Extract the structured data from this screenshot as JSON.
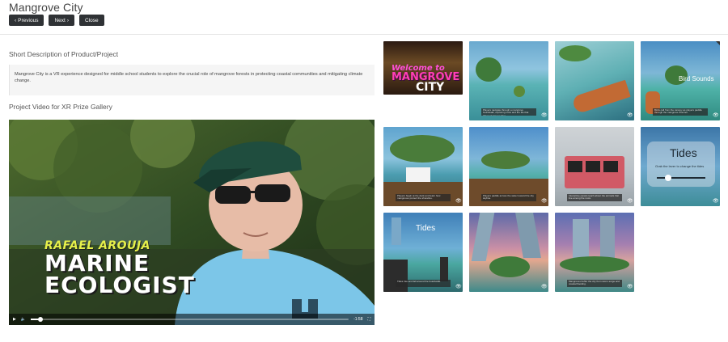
{
  "page": {
    "title": "Mangrove City"
  },
  "nav": {
    "previous": "Previous",
    "next": "Next",
    "close": "Close"
  },
  "description": {
    "heading": "Short Description of Product/Project",
    "text": "Mangrove City is a VR experience designed for middle school students to explore the crucial role of mangrove forests in protecting coastal communities and mitigating climate change."
  },
  "video": {
    "heading": "Project Video for XR Prize Gallery",
    "lower_third_name": "RAFAEL AROUJA",
    "lower_third_title_1": "MARINE",
    "lower_third_title_2": "ECOLOGIST",
    "time_remaining": "-1:58",
    "progress_fraction": 0.03
  },
  "gallery": {
    "items": [
      {
        "overlay_1": "Welcome to",
        "overlay_2": "MANGROVE",
        "overlay_3": "CITY"
      },
      {
        "caption": "Players navigate through a mangrove boardwalk, exploring roots and the life that thrives between tides."
      },
      {
        "caption": ""
      },
      {
        "overlay": "Bird Sounds",
        "caption": "Birds call from the canopy as players paddle through the mangrove channel."
      },
      {
        "caption": "Players begin at the dock and learn how mangroves protect the shoreline."
      },
      {
        "caption": "Players paddle across the water toward the city skyline."
      },
      {
        "caption": "Interactive panels teach about the animals that live among the roots."
      },
      {
        "overlay": "Tides",
        "overlay_sub": "Grab the lever to change the tides",
        "caption": ""
      },
      {
        "overlay": "Tides",
        "caption": "Tides rise and fall around the boardwalk."
      },
      {
        "caption": ""
      },
      {
        "caption": "Mangroves buffer the city from storm surge and coastal flooding."
      }
    ]
  }
}
